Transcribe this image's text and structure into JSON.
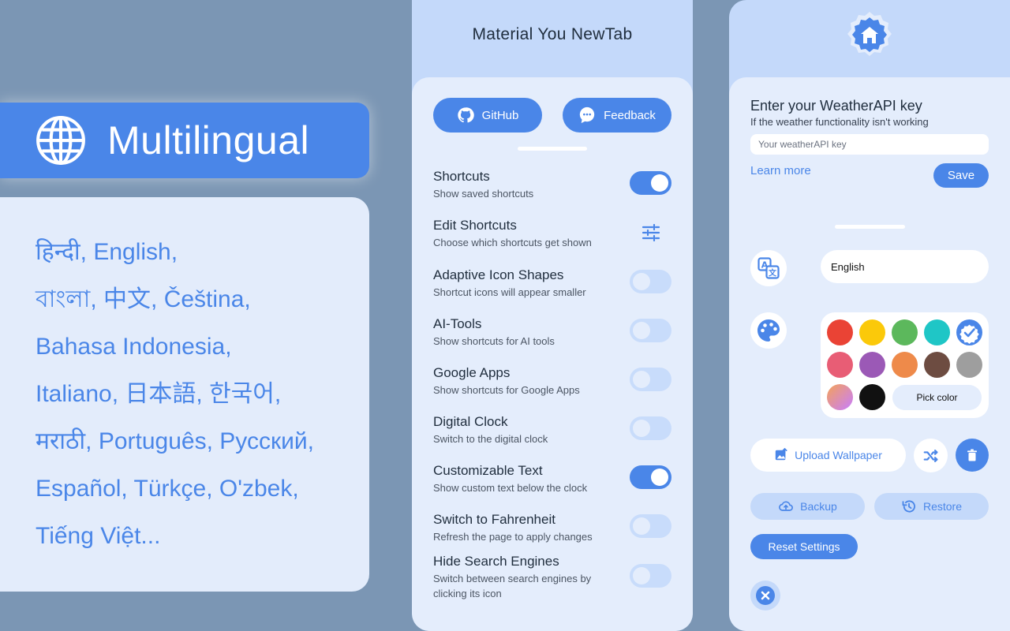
{
  "promo": {
    "banner_title": "Multilingual",
    "languages_lines": [
      "हिन्दी, English,",
      "বাংলা, 中文, Čeština,",
      "Bahasa Indonesia,",
      "Italiano, 日本語, 한국어,",
      "मराठी, Português, Русский,",
      "Español, Türkçe, O'zbek,",
      "Tiếng Việt..."
    ]
  },
  "settings_panel": {
    "app_title": "Material You NewTab",
    "github_label": "GitHub",
    "feedback_label": "Feedback",
    "items": [
      {
        "title": "Shortcuts",
        "subtitle": "Show saved shortcuts",
        "control": "toggle",
        "on": true
      },
      {
        "title": "Edit Shortcuts",
        "subtitle": "Choose which shortcuts get shown",
        "control": "tune-icon"
      },
      {
        "title": "Adaptive Icon Shapes",
        "subtitle": "Shortcut icons will appear smaller",
        "control": "toggle",
        "on": false
      },
      {
        "title": "AI-Tools",
        "subtitle": "Show shortcuts for AI tools",
        "control": "toggle",
        "on": false
      },
      {
        "title": "Google Apps",
        "subtitle": "Show shortcuts for Google Apps",
        "control": "toggle",
        "on": false
      },
      {
        "title": "Digital Clock",
        "subtitle": "Switch to the digital clock",
        "control": "toggle",
        "on": false
      },
      {
        "title": "Customizable Text",
        "subtitle": "Show custom text below the clock",
        "control": "toggle",
        "on": true
      },
      {
        "title": "Switch to Fahrenheit",
        "subtitle": "Refresh the page to apply changes",
        "control": "toggle",
        "on": false
      },
      {
        "title": "Hide Search Engines",
        "subtitle": "Switch between search engines by clicking its icon",
        "control": "toggle",
        "on": false
      }
    ]
  },
  "right_panel": {
    "weather_title": "Enter your WeatherAPI key",
    "weather_subtitle": "If the weather functionality isn't working",
    "weather_placeholder": "Your weatherAPI key",
    "learn_more": "Learn more",
    "save": "Save",
    "language_value": "English",
    "colors": [
      "#ea4335",
      "#fbc90a",
      "#5cb85c",
      "#1fc6c6",
      "#4a86e8",
      "#e85d75",
      "#9b59b6",
      "#ee8a4a",
      "#6d4c41",
      "#9e9e9e"
    ],
    "selected_color": "#4a86e8",
    "pick_color": "Pick color",
    "upload_wallpaper": "Upload Wallpaper",
    "backup": "Backup",
    "restore": "Restore",
    "reset_settings": "Reset Settings"
  },
  "accent": "#4a86e8"
}
